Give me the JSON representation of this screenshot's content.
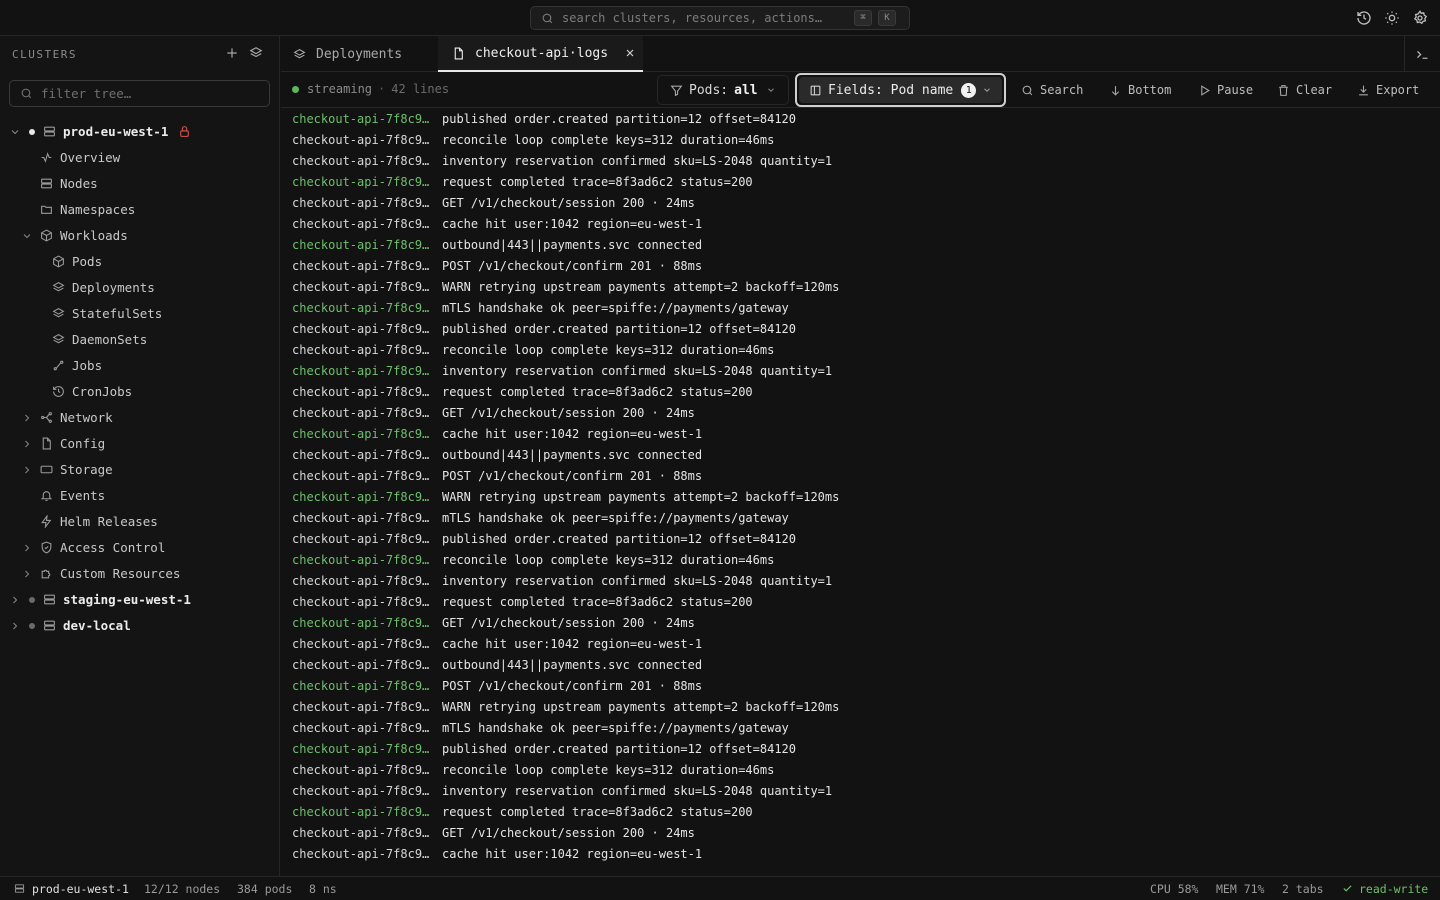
{
  "search": {
    "placeholder": "search clusters, resources, actions…",
    "key1": "⌘",
    "key2": "K"
  },
  "sidebar": {
    "heading": "CLUSTERS",
    "filter_placeholder": "filter tree…",
    "clusters": [
      {
        "name": "prod-eu-west-1",
        "status_color": "#e8e8e8",
        "locked": true
      },
      {
        "name": "staging-eu-west-1",
        "status_color": "#6a6a6a"
      },
      {
        "name": "dev-local",
        "status_color": "#6a6a6a"
      }
    ],
    "items": [
      {
        "label": "Overview",
        "icon": "activity-icon"
      },
      {
        "label": "Nodes",
        "icon": "server-icon"
      },
      {
        "label": "Namespaces",
        "icon": "folder-icon"
      },
      {
        "label": "Workloads",
        "icon": "box-icon"
      },
      {
        "label": "Pods",
        "icon": "box-icon"
      },
      {
        "label": "Deployments",
        "icon": "layers-icon"
      },
      {
        "label": "StatefulSets",
        "icon": "layers-icon"
      },
      {
        "label": "DaemonSets",
        "icon": "layers-icon"
      },
      {
        "label": "Jobs",
        "icon": "route-icon"
      },
      {
        "label": "CronJobs",
        "icon": "history-icon"
      },
      {
        "label": "Network",
        "icon": "network-icon"
      },
      {
        "label": "Config",
        "icon": "file-icon"
      },
      {
        "label": "Storage",
        "icon": "storage-icon"
      },
      {
        "label": "Events",
        "icon": "bell-icon"
      },
      {
        "label": "Helm Releases",
        "icon": "zap-icon"
      },
      {
        "label": "Access Control",
        "icon": "shield-icon"
      },
      {
        "label": "Custom Resources",
        "icon": "puzzle-icon"
      }
    ]
  },
  "tabs": [
    {
      "label": "Deployments",
      "icon": "layers-icon"
    },
    {
      "label": "checkout-api·logs",
      "icon": "file-icon"
    }
  ],
  "toolbar": {
    "status": "streaming",
    "lines": "42 lines",
    "pods_label": "Pods:",
    "pods_value": "all",
    "fields_label": "Fields: Pod name",
    "fields_count": "1",
    "search": "Search",
    "bottom": "Bottom",
    "pause": "Pause",
    "clear": "Clear",
    "export": "Export"
  },
  "logs": {
    "green_color": "#6cbf6c",
    "entries": [
      {
        "pod": "checkout-api-7f8c9…",
        "msg": "published order.created partition=12 offset=84120",
        "green": true
      },
      {
        "pod": "checkout-api-7f8c9…",
        "msg": "reconcile loop complete keys=312 duration=46ms",
        "green": false
      },
      {
        "pod": "checkout-api-7f8c9…",
        "msg": "inventory reservation confirmed sku=LS-2048 quantity=1",
        "green": false
      },
      {
        "pod": "checkout-api-7f8c9…",
        "msg": "request completed trace=8f3ad6c2 status=200",
        "green": true
      },
      {
        "pod": "checkout-api-7f8c9…",
        "msg": "GET /v1/checkout/session 200 · 24ms",
        "green": false
      },
      {
        "pod": "checkout-api-7f8c9…",
        "msg": "cache hit user:1042 region=eu-west-1",
        "green": false
      },
      {
        "pod": "checkout-api-7f8c9…",
        "msg": "outbound|443||payments.svc connected",
        "green": true
      },
      {
        "pod": "checkout-api-7f8c9…",
        "msg": "POST /v1/checkout/confirm 201 · 88ms",
        "green": false
      },
      {
        "pod": "checkout-api-7f8c9…",
        "msg": "WARN retrying upstream payments attempt=2 backoff=120ms",
        "green": false
      },
      {
        "pod": "checkout-api-7f8c9…",
        "msg": "mTLS handshake ok peer=spiffe://payments/gateway",
        "green": true
      },
      {
        "pod": "checkout-api-7f8c9…",
        "msg": "published order.created partition=12 offset=84120",
        "green": false
      },
      {
        "pod": "checkout-api-7f8c9…",
        "msg": "reconcile loop complete keys=312 duration=46ms",
        "green": false
      },
      {
        "pod": "checkout-api-7f8c9…",
        "msg": "inventory reservation confirmed sku=LS-2048 quantity=1",
        "green": true
      },
      {
        "pod": "checkout-api-7f8c9…",
        "msg": "request completed trace=8f3ad6c2 status=200",
        "green": false
      },
      {
        "pod": "checkout-api-7f8c9…",
        "msg": "GET /v1/checkout/session 200 · 24ms",
        "green": false
      },
      {
        "pod": "checkout-api-7f8c9…",
        "msg": "cache hit user:1042 region=eu-west-1",
        "green": true
      },
      {
        "pod": "checkout-api-7f8c9…",
        "msg": "outbound|443||payments.svc connected",
        "green": false
      },
      {
        "pod": "checkout-api-7f8c9…",
        "msg": "POST /v1/checkout/confirm 201 · 88ms",
        "green": false
      },
      {
        "pod": "checkout-api-7f8c9…",
        "msg": "WARN retrying upstream payments attempt=2 backoff=120ms",
        "green": true
      },
      {
        "pod": "checkout-api-7f8c9…",
        "msg": "mTLS handshake ok peer=spiffe://payments/gateway",
        "green": false
      },
      {
        "pod": "checkout-api-7f8c9…",
        "msg": "published order.created partition=12 offset=84120",
        "green": false
      },
      {
        "pod": "checkout-api-7f8c9…",
        "msg": "reconcile loop complete keys=312 duration=46ms",
        "green": true
      },
      {
        "pod": "checkout-api-7f8c9…",
        "msg": "inventory reservation confirmed sku=LS-2048 quantity=1",
        "green": false
      },
      {
        "pod": "checkout-api-7f8c9…",
        "msg": "request completed trace=8f3ad6c2 status=200",
        "green": false
      },
      {
        "pod": "checkout-api-7f8c9…",
        "msg": "GET /v1/checkout/session 200 · 24ms",
        "green": true
      },
      {
        "pod": "checkout-api-7f8c9…",
        "msg": "cache hit user:1042 region=eu-west-1",
        "green": false
      },
      {
        "pod": "checkout-api-7f8c9…",
        "msg": "outbound|443||payments.svc connected",
        "green": false
      },
      {
        "pod": "checkout-api-7f8c9…",
        "msg": "POST /v1/checkout/confirm 201 · 88ms",
        "green": true
      },
      {
        "pod": "checkout-api-7f8c9…",
        "msg": "WARN retrying upstream payments attempt=2 backoff=120ms",
        "green": false
      },
      {
        "pod": "checkout-api-7f8c9…",
        "msg": "mTLS handshake ok peer=spiffe://payments/gateway",
        "green": false
      },
      {
        "pod": "checkout-api-7f8c9…",
        "msg": "published order.created partition=12 offset=84120",
        "green": true
      },
      {
        "pod": "checkout-api-7f8c9…",
        "msg": "reconcile loop complete keys=312 duration=46ms",
        "green": false
      },
      {
        "pod": "checkout-api-7f8c9…",
        "msg": "inventory reservation confirmed sku=LS-2048 quantity=1",
        "green": false
      },
      {
        "pod": "checkout-api-7f8c9…",
        "msg": "request completed trace=8f3ad6c2 status=200",
        "green": true
      },
      {
        "pod": "checkout-api-7f8c9…",
        "msg": "GET /v1/checkout/session 200 · 24ms",
        "green": false
      },
      {
        "pod": "checkout-api-7f8c9…",
        "msg": "cache hit user:1042 region=eu-west-1",
        "green": false
      }
    ]
  },
  "status": {
    "cluster": "prod-eu-west-1",
    "nodes": "12/12 nodes",
    "pods": "384 pods",
    "ns": "8 ns",
    "cpu": "CPU 58%",
    "mem": "MEM 71%",
    "tabs": "2 tabs",
    "mode": "read-write"
  }
}
